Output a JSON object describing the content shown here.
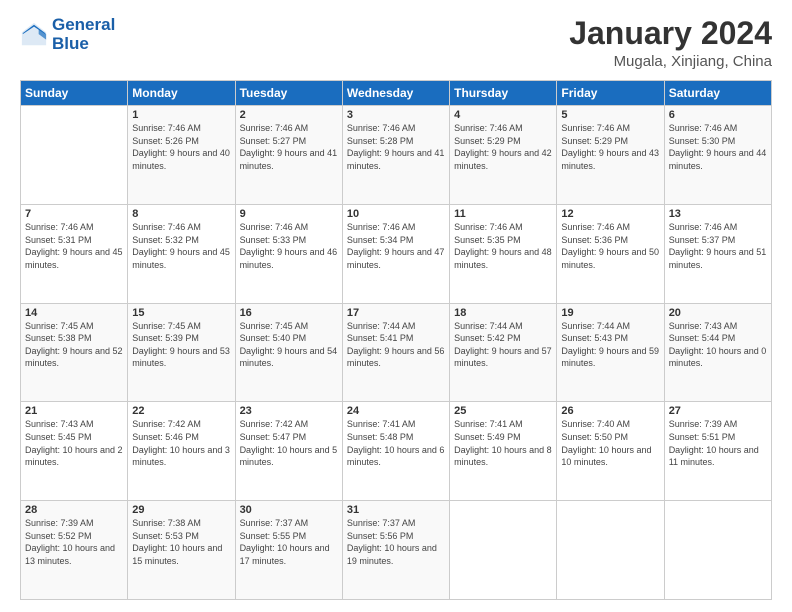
{
  "logo": {
    "line1": "General",
    "line2": "Blue"
  },
  "title": "January 2024",
  "subtitle": "Mugala, Xinjiang, China",
  "days_of_week": [
    "Sunday",
    "Monday",
    "Tuesday",
    "Wednesday",
    "Thursday",
    "Friday",
    "Saturday"
  ],
  "weeks": [
    [
      {
        "day": "",
        "sunrise": "",
        "sunset": "",
        "daylight": ""
      },
      {
        "day": "1",
        "sunrise": "Sunrise: 7:46 AM",
        "sunset": "Sunset: 5:26 PM",
        "daylight": "Daylight: 9 hours and 40 minutes."
      },
      {
        "day": "2",
        "sunrise": "Sunrise: 7:46 AM",
        "sunset": "Sunset: 5:27 PM",
        "daylight": "Daylight: 9 hours and 41 minutes."
      },
      {
        "day": "3",
        "sunrise": "Sunrise: 7:46 AM",
        "sunset": "Sunset: 5:28 PM",
        "daylight": "Daylight: 9 hours and 41 minutes."
      },
      {
        "day": "4",
        "sunrise": "Sunrise: 7:46 AM",
        "sunset": "Sunset: 5:29 PM",
        "daylight": "Daylight: 9 hours and 42 minutes."
      },
      {
        "day": "5",
        "sunrise": "Sunrise: 7:46 AM",
        "sunset": "Sunset: 5:29 PM",
        "daylight": "Daylight: 9 hours and 43 minutes."
      },
      {
        "day": "6",
        "sunrise": "Sunrise: 7:46 AM",
        "sunset": "Sunset: 5:30 PM",
        "daylight": "Daylight: 9 hours and 44 minutes."
      }
    ],
    [
      {
        "day": "7",
        "sunrise": "Sunrise: 7:46 AM",
        "sunset": "Sunset: 5:31 PM",
        "daylight": "Daylight: 9 hours and 45 minutes."
      },
      {
        "day": "8",
        "sunrise": "Sunrise: 7:46 AM",
        "sunset": "Sunset: 5:32 PM",
        "daylight": "Daylight: 9 hours and 45 minutes."
      },
      {
        "day": "9",
        "sunrise": "Sunrise: 7:46 AM",
        "sunset": "Sunset: 5:33 PM",
        "daylight": "Daylight: 9 hours and 46 minutes."
      },
      {
        "day": "10",
        "sunrise": "Sunrise: 7:46 AM",
        "sunset": "Sunset: 5:34 PM",
        "daylight": "Daylight: 9 hours and 47 minutes."
      },
      {
        "day": "11",
        "sunrise": "Sunrise: 7:46 AM",
        "sunset": "Sunset: 5:35 PM",
        "daylight": "Daylight: 9 hours and 48 minutes."
      },
      {
        "day": "12",
        "sunrise": "Sunrise: 7:46 AM",
        "sunset": "Sunset: 5:36 PM",
        "daylight": "Daylight: 9 hours and 50 minutes."
      },
      {
        "day": "13",
        "sunrise": "Sunrise: 7:46 AM",
        "sunset": "Sunset: 5:37 PM",
        "daylight": "Daylight: 9 hours and 51 minutes."
      }
    ],
    [
      {
        "day": "14",
        "sunrise": "Sunrise: 7:45 AM",
        "sunset": "Sunset: 5:38 PM",
        "daylight": "Daylight: 9 hours and 52 minutes."
      },
      {
        "day": "15",
        "sunrise": "Sunrise: 7:45 AM",
        "sunset": "Sunset: 5:39 PM",
        "daylight": "Daylight: 9 hours and 53 minutes."
      },
      {
        "day": "16",
        "sunrise": "Sunrise: 7:45 AM",
        "sunset": "Sunset: 5:40 PM",
        "daylight": "Daylight: 9 hours and 54 minutes."
      },
      {
        "day": "17",
        "sunrise": "Sunrise: 7:44 AM",
        "sunset": "Sunset: 5:41 PM",
        "daylight": "Daylight: 9 hours and 56 minutes."
      },
      {
        "day": "18",
        "sunrise": "Sunrise: 7:44 AM",
        "sunset": "Sunset: 5:42 PM",
        "daylight": "Daylight: 9 hours and 57 minutes."
      },
      {
        "day": "19",
        "sunrise": "Sunrise: 7:44 AM",
        "sunset": "Sunset: 5:43 PM",
        "daylight": "Daylight: 9 hours and 59 minutes."
      },
      {
        "day": "20",
        "sunrise": "Sunrise: 7:43 AM",
        "sunset": "Sunset: 5:44 PM",
        "daylight": "Daylight: 10 hours and 0 minutes."
      }
    ],
    [
      {
        "day": "21",
        "sunrise": "Sunrise: 7:43 AM",
        "sunset": "Sunset: 5:45 PM",
        "daylight": "Daylight: 10 hours and 2 minutes."
      },
      {
        "day": "22",
        "sunrise": "Sunrise: 7:42 AM",
        "sunset": "Sunset: 5:46 PM",
        "daylight": "Daylight: 10 hours and 3 minutes."
      },
      {
        "day": "23",
        "sunrise": "Sunrise: 7:42 AM",
        "sunset": "Sunset: 5:47 PM",
        "daylight": "Daylight: 10 hours and 5 minutes."
      },
      {
        "day": "24",
        "sunrise": "Sunrise: 7:41 AM",
        "sunset": "Sunset: 5:48 PM",
        "daylight": "Daylight: 10 hours and 6 minutes."
      },
      {
        "day": "25",
        "sunrise": "Sunrise: 7:41 AM",
        "sunset": "Sunset: 5:49 PM",
        "daylight": "Daylight: 10 hours and 8 minutes."
      },
      {
        "day": "26",
        "sunrise": "Sunrise: 7:40 AM",
        "sunset": "Sunset: 5:50 PM",
        "daylight": "Daylight: 10 hours and 10 minutes."
      },
      {
        "day": "27",
        "sunrise": "Sunrise: 7:39 AM",
        "sunset": "Sunset: 5:51 PM",
        "daylight": "Daylight: 10 hours and 11 minutes."
      }
    ],
    [
      {
        "day": "28",
        "sunrise": "Sunrise: 7:39 AM",
        "sunset": "Sunset: 5:52 PM",
        "daylight": "Daylight: 10 hours and 13 minutes."
      },
      {
        "day": "29",
        "sunrise": "Sunrise: 7:38 AM",
        "sunset": "Sunset: 5:53 PM",
        "daylight": "Daylight: 10 hours and 15 minutes."
      },
      {
        "day": "30",
        "sunrise": "Sunrise: 7:37 AM",
        "sunset": "Sunset: 5:55 PM",
        "daylight": "Daylight: 10 hours and 17 minutes."
      },
      {
        "day": "31",
        "sunrise": "Sunrise: 7:37 AM",
        "sunset": "Sunset: 5:56 PM",
        "daylight": "Daylight: 10 hours and 19 minutes."
      },
      {
        "day": "",
        "sunrise": "",
        "sunset": "",
        "daylight": ""
      },
      {
        "day": "",
        "sunrise": "",
        "sunset": "",
        "daylight": ""
      },
      {
        "day": "",
        "sunrise": "",
        "sunset": "",
        "daylight": ""
      }
    ]
  ]
}
